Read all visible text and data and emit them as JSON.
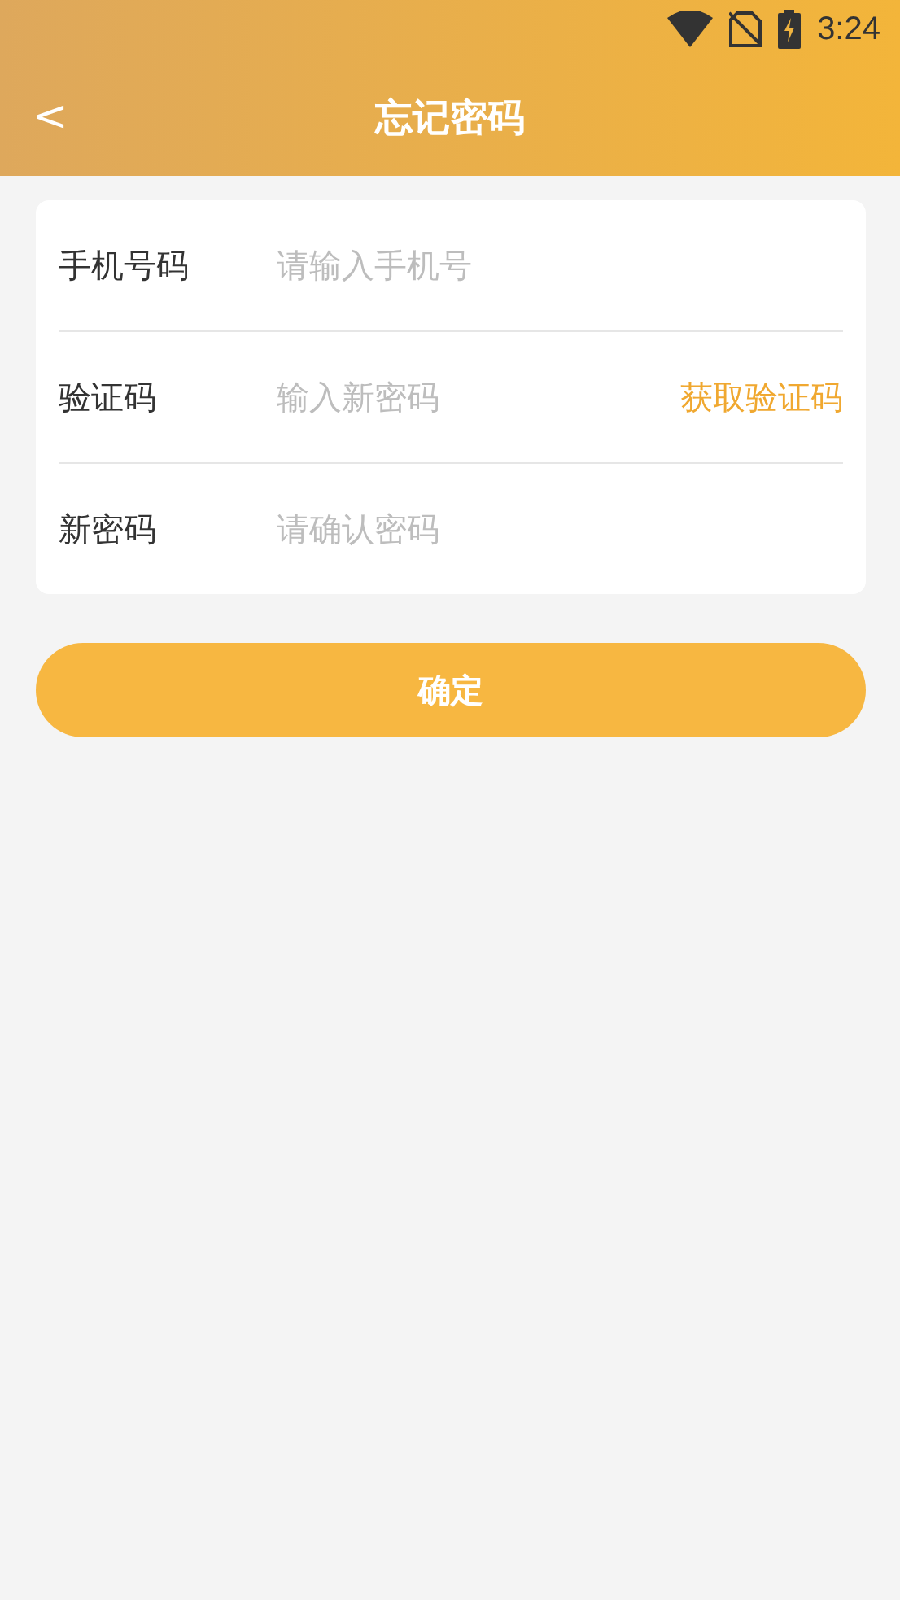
{
  "status_bar": {
    "time": "3:24"
  },
  "header": {
    "back": "<",
    "title": "忘记密码"
  },
  "form": {
    "fields": [
      {
        "label": "手机号码",
        "placeholder": "请输入手机号"
      },
      {
        "label": "验证码",
        "placeholder": "输入新密码",
        "action": "获取验证码"
      },
      {
        "label": "新密码",
        "placeholder": "请确认密码"
      }
    ]
  },
  "submit": {
    "label": "确定"
  }
}
